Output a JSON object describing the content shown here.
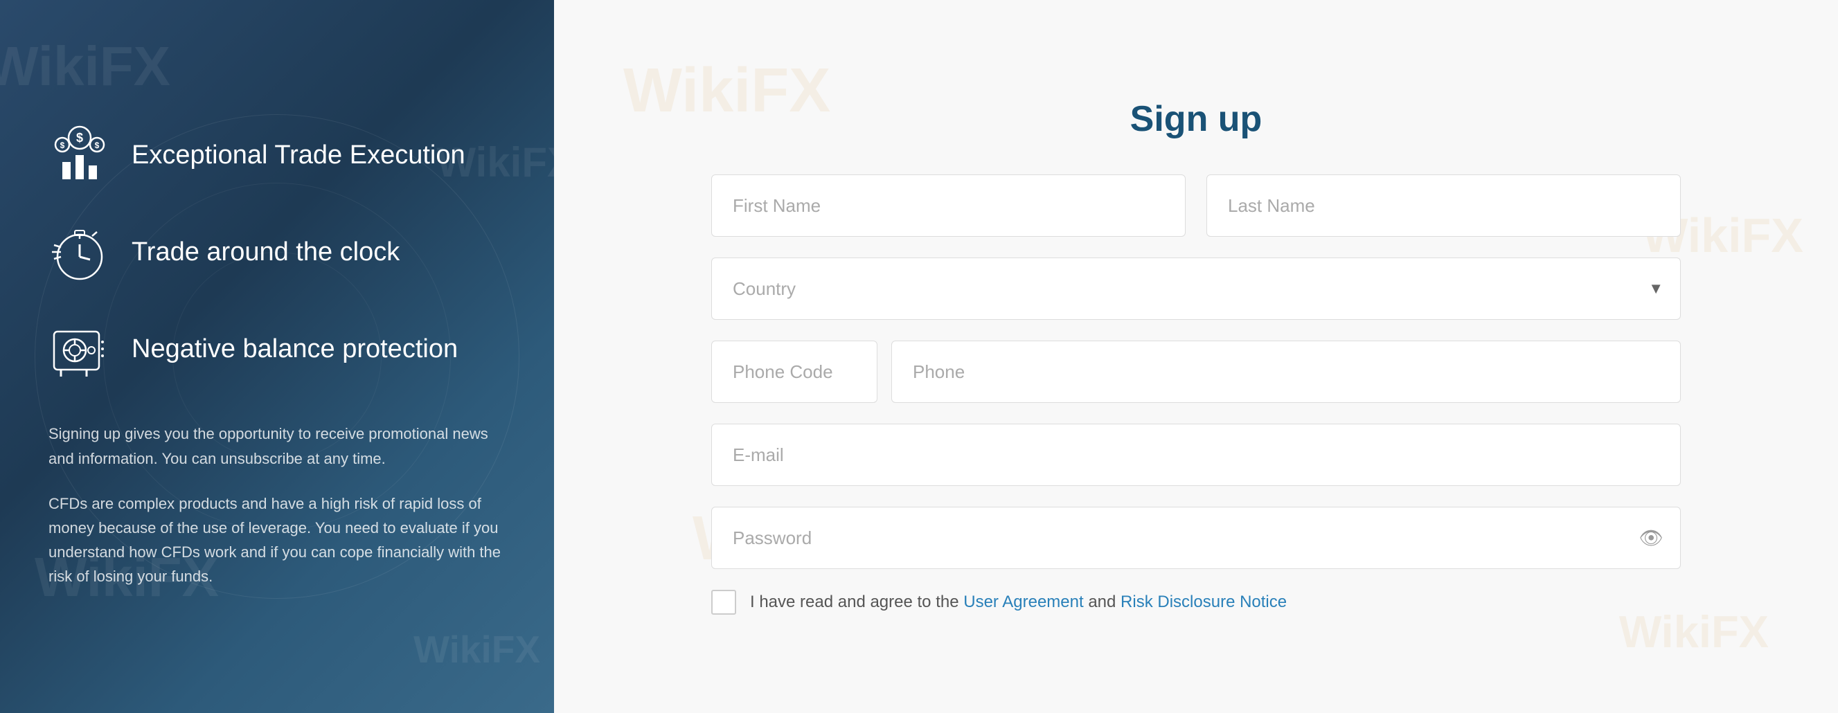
{
  "left": {
    "features": [
      {
        "id": "exceptional-trade",
        "title": "Exceptional Trade Execution",
        "icon": "chart-icon"
      },
      {
        "id": "trade-clock",
        "title": "Trade around the clock",
        "icon": "clock-icon"
      },
      {
        "id": "negative-balance",
        "title": "Negative balance protection",
        "icon": "safe-icon"
      }
    ],
    "disclaimer1": "Signing up gives you the opportunity to receive promotional news and information. You can unsubscribe at any time.",
    "disclaimer2": "CFDs are complex products and have a high risk of rapid loss of money because of the use of leverage. You need to evaluate if you understand how CFDs work and if you can cope financially with the risk of losing your funds.",
    "watermarks": [
      "WikiFX",
      "WikiFX",
      "WikiFX",
      "WikiFX"
    ]
  },
  "right": {
    "title": "Sign up",
    "form": {
      "first_name_placeholder": "First Name",
      "last_name_placeholder": "Last Name",
      "country_placeholder": "Country",
      "phone_code_placeholder": "Phone Code",
      "phone_placeholder": "Phone",
      "email_placeholder": "E-mail",
      "password_placeholder": "Password"
    },
    "agreement": {
      "text_before": "I have read and agree to the ",
      "link1_text": "User Agreement",
      "text_between": " and ",
      "link2_text": "Risk Disclosure Notice"
    },
    "watermarks": [
      "WikiFX",
      "WikiFX",
      "WikiFX",
      "WikiFX"
    ]
  },
  "colors": {
    "brand_blue": "#1a5276",
    "link_blue": "#2980b9"
  }
}
